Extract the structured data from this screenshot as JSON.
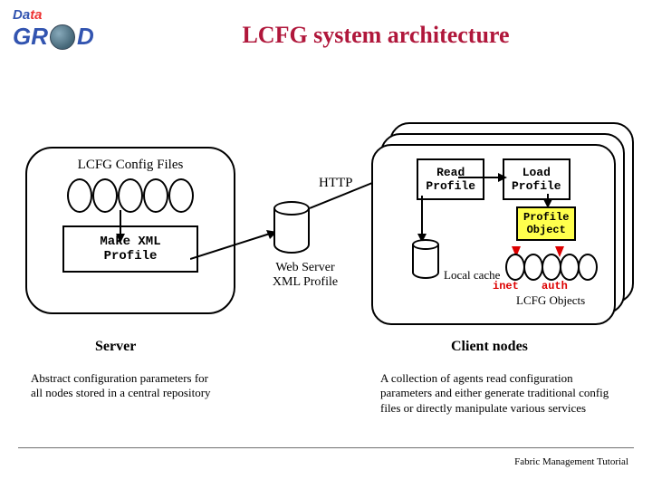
{
  "logo": {
    "word1": "Data",
    "word2": "GRID"
  },
  "title": "LCFG system architecture",
  "server_box_heading": "LCFG Config Files",
  "make_xml_label": "Make XML\nProfile",
  "http_label": "HTTP",
  "web_server_label": "Web Server\nXML Profile",
  "read_profile_label": "Read\nProfile",
  "load_profile_label": "Load\nProfile",
  "profile_object_label": "Profile\nObject",
  "local_cache_label": "Local cache",
  "inet_label": "inet",
  "auth_label": "auth",
  "lcfg_objects_label": "LCFG Objects",
  "server_section_label": "Server",
  "client_section_label": "Client nodes",
  "server_description": "Abstract configuration parameters for all nodes stored in a central repository",
  "client_description": "A collection of agents read configuration parameters and either generate traditional config files or directly manipulate various services",
  "footer": "Fabric Management Tutorial"
}
